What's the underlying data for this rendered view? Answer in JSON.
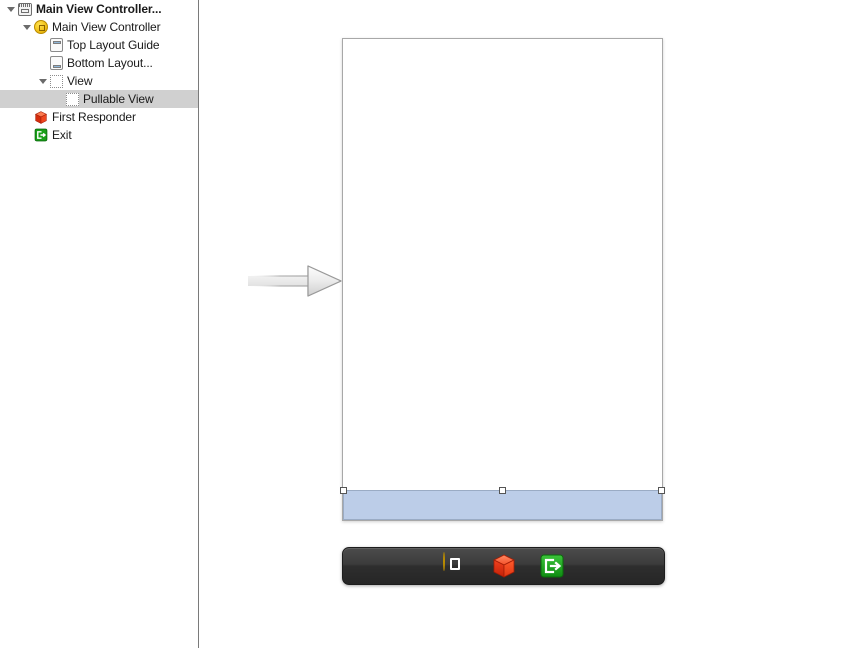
{
  "window": {
    "kind": "storyboard-interface-builder"
  },
  "outline": {
    "panel_name": "document-outline",
    "items": [
      {
        "label": "Main View Controller...",
        "icon": "scene-icon",
        "indent": 0,
        "twisty": "open",
        "selected": false,
        "bold": true
      },
      {
        "label": "Main View Controller",
        "icon": "view-controller-icon",
        "indent": 1,
        "twisty": "open",
        "selected": false,
        "bold": false
      },
      {
        "label": "Top Layout Guide",
        "icon": "top-layout-guide-icon",
        "indent": 2,
        "twisty": "none",
        "selected": false,
        "bold": false
      },
      {
        "label": "Bottom Layout...",
        "icon": "bottom-layout-guide-icon",
        "indent": 2,
        "twisty": "none",
        "selected": false,
        "bold": false
      },
      {
        "label": "View",
        "icon": "view-icon",
        "indent": 2,
        "twisty": "open",
        "selected": false,
        "bold": false
      },
      {
        "label": "Pullable View",
        "icon": "view-icon",
        "indent": 3,
        "twisty": "none",
        "selected": true,
        "bold": false
      },
      {
        "label": "First Responder",
        "icon": "first-responder-icon",
        "indent": 1,
        "twisty": "none",
        "selected": false,
        "bold": false
      },
      {
        "label": "Exit",
        "icon": "exit-icon",
        "indent": 1,
        "twisty": "none",
        "selected": false,
        "bold": false
      }
    ]
  },
  "canvas": {
    "panel_name": "storyboard-canvas",
    "scene": {
      "name": "main-view-controller-scene",
      "selected_subview_label": "Pullable View",
      "selected_subview_fill": "#bccde8",
      "selected_subview_border": "#9aabc4",
      "handles": [
        "top-left",
        "top-center",
        "top-right"
      ]
    },
    "entry_point_arrow": {
      "name": "initial-view-controller-arrow",
      "direction": "right"
    },
    "dock": {
      "name": "scene-dock",
      "items": [
        {
          "icon": "view-controller-icon",
          "label": "Main View Controller"
        },
        {
          "icon": "first-responder-icon",
          "label": "First Responder"
        },
        {
          "icon": "exit-icon",
          "label": "Exit"
        }
      ]
    }
  },
  "colors": {
    "selection_row": "#d0d0d0",
    "view_controller_yellow": "#f2c21a",
    "first_responder_red": "#e8391c",
    "exit_green": "#1aa019",
    "canvas_background": "#ffffff",
    "divider": "#7a7a7a"
  }
}
